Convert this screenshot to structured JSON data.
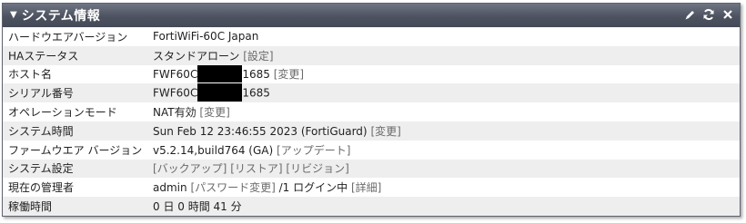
{
  "widget": {
    "title": "システム情報"
  },
  "rows": {
    "hw_version": {
      "label": "ハードウエアバージョン",
      "value": "FortiWiFi-60C Japan"
    },
    "ha_status": {
      "label": "HAステータス",
      "value": "スタンドアローン",
      "link": "[設定]"
    },
    "hostname": {
      "label": "ホスト名",
      "value_prefix": "FWF60C",
      "value_suffix": "1685",
      "link": "[変更]"
    },
    "serial": {
      "label": "シリアル番号",
      "value_prefix": "FWF60C",
      "value_suffix": "1685"
    },
    "op_mode": {
      "label": "オペレーションモード",
      "value": "NAT有効",
      "link": "[変更]"
    },
    "system_time": {
      "label": "システム時間",
      "value": "Sun Feb 12 23:46:55 2023 (FortiGuard)",
      "link": "[変更]"
    },
    "firmware": {
      "label": "ファームウエア バージョン",
      "value": "v5.2.14,build764 (GA)",
      "link": "[アップデート]"
    },
    "sys_config": {
      "label": "システム設定",
      "link1": "[バックアップ]",
      "link2": "[リストア]",
      "link3": "[リビジョン]"
    },
    "admin": {
      "label": "現在の管理者",
      "value": "admin",
      "link1": "[パスワード変更]",
      "count_text": "/1 ログイン中",
      "link2": "[詳細]"
    },
    "uptime": {
      "label": "稼働時間",
      "value": "0 日 0 時間 41 分"
    }
  }
}
